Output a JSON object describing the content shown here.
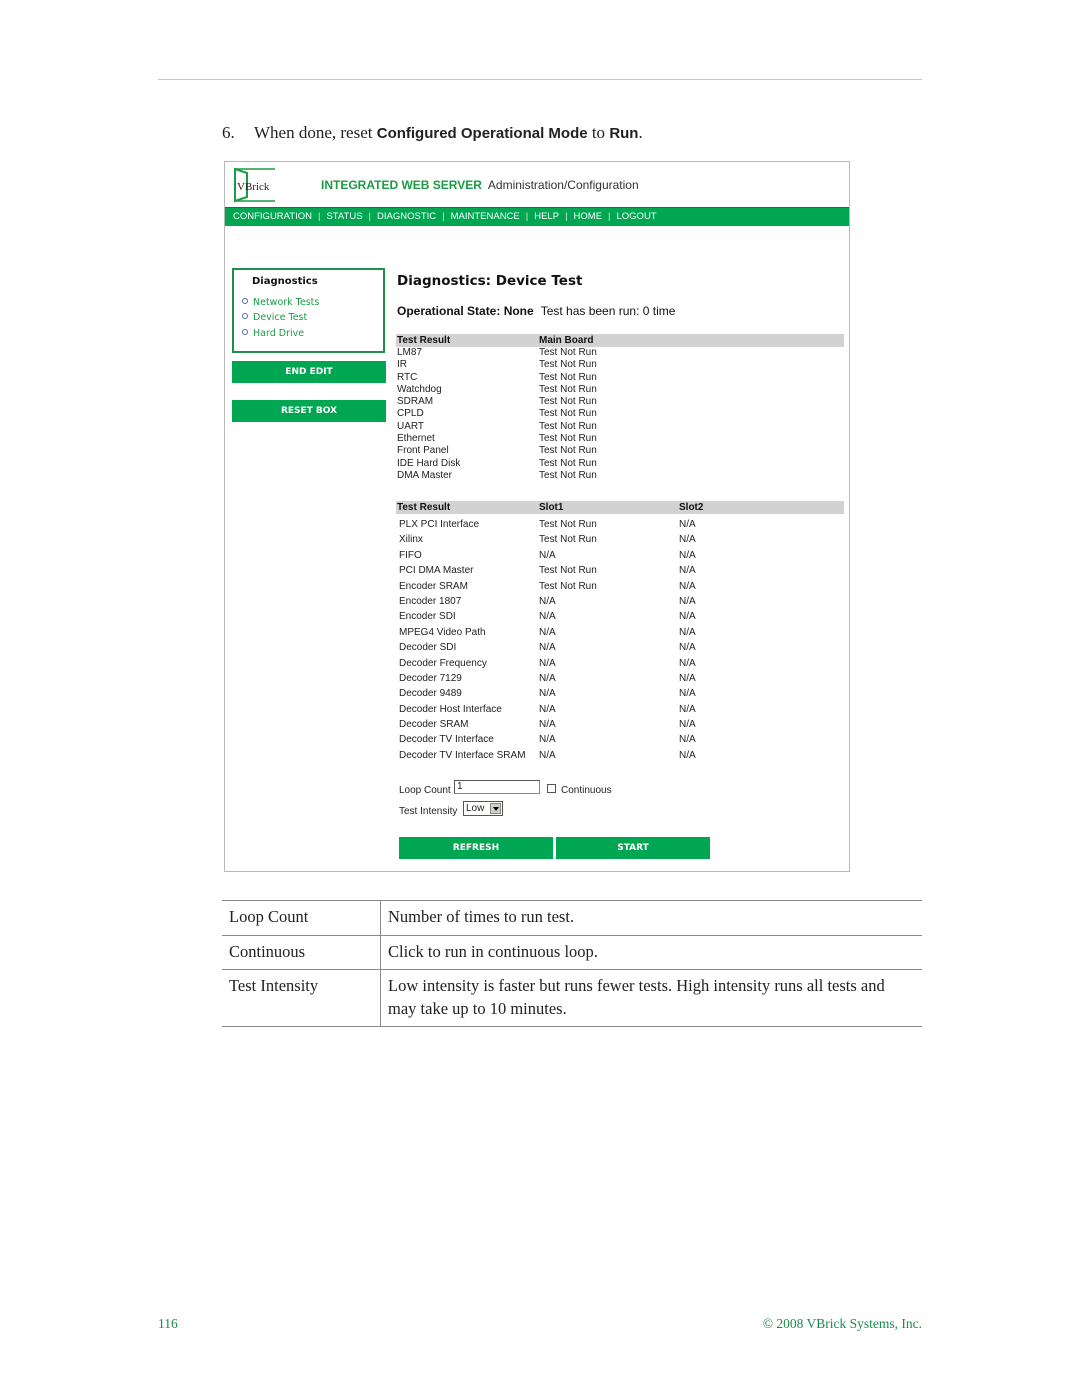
{
  "instruction": {
    "number": "6.",
    "text_before": "When done, reset ",
    "ui_term_1": "Configured Operational Mode",
    "text_middle": " to ",
    "ui_term_2": "Run",
    "text_after": "."
  },
  "screenshot": {
    "logo_text": "VBrick",
    "header_title": "INTEGRATED WEB SERVER",
    "header_subtitle": "Administration/Configuration",
    "nav": [
      "CONFIGURATION",
      "STATUS",
      "DIAGNOSTIC",
      "MAINTENANCE",
      "HELP",
      "HOME",
      "LOGOUT"
    ],
    "sidebar": {
      "title": "Diagnostics",
      "links": [
        "Network Tests",
        "Device Test",
        "Hard Drive"
      ],
      "end_edit": "END EDIT",
      "reset_box": "RESET BOX"
    },
    "main": {
      "title": "Diagnostics: Device Test",
      "op_state_label": "Operational State: None",
      "run_count_text": "Test has been run: 0 time"
    },
    "main_board_table": {
      "headers": [
        "Test Result",
        "Main Board"
      ],
      "rows": [
        [
          "LM87",
          "Test Not Run"
        ],
        [
          "IR",
          "Test Not Run"
        ],
        [
          "RTC",
          "Test Not Run"
        ],
        [
          "Watchdog",
          "Test Not Run"
        ],
        [
          "SDRAM",
          "Test Not Run"
        ],
        [
          "CPLD",
          "Test Not Run"
        ],
        [
          "UART",
          "Test Not Run"
        ],
        [
          "Ethernet",
          "Test Not Run"
        ],
        [
          "Front Panel",
          "Test Not Run"
        ],
        [
          "IDE Hard Disk",
          "Test Not Run"
        ],
        [
          "DMA Master",
          "Test Not Run"
        ]
      ]
    },
    "slot_table": {
      "headers": [
        "Test Result",
        "Slot1",
        "Slot2"
      ],
      "rows": [
        [
          "PLX PCI Interface",
          "Test Not Run",
          "N/A"
        ],
        [
          "Xilinx",
          "Test Not Run",
          "N/A"
        ],
        [
          "FIFO",
          "N/A",
          "N/A"
        ],
        [
          "PCI DMA Master",
          "Test Not Run",
          "N/A"
        ],
        [
          "Encoder SRAM",
          "Test Not Run",
          "N/A"
        ],
        [
          "Encoder 1807",
          "N/A",
          "N/A"
        ],
        [
          "Encoder SDI",
          "N/A",
          "N/A"
        ],
        [
          "MPEG4 Video Path",
          "N/A",
          "N/A"
        ],
        [
          "Decoder SDI",
          "N/A",
          "N/A"
        ],
        [
          "Decoder Frequency",
          "N/A",
          "N/A"
        ],
        [
          "Decoder 7129",
          "N/A",
          "N/A"
        ],
        [
          "Decoder 9489",
          "N/A",
          "N/A"
        ],
        [
          "Decoder Host Interface",
          "N/A",
          "N/A"
        ],
        [
          "Decoder SRAM",
          "N/A",
          "N/A"
        ],
        [
          "Decoder TV Interface",
          "N/A",
          "N/A"
        ],
        [
          "Decoder TV Interface SRAM",
          "N/A",
          "N/A"
        ]
      ]
    },
    "form": {
      "loop_count_label": "Loop Count",
      "loop_count_value": "1",
      "continuous_label": "Continuous",
      "continuous_checked": false,
      "test_intensity_label": "Test Intensity",
      "test_intensity_value": "Low",
      "refresh": "REFRESH",
      "start": "START"
    }
  },
  "description_table": [
    [
      "Loop Count",
      "Number of times to run test."
    ],
    [
      "Continuous",
      "Click to run in continuous loop."
    ],
    [
      "Test Intensity",
      "Low intensity is faster but runs fewer tests. High intensity runs all tests and may take up to 10 minutes."
    ]
  ],
  "footer": {
    "page_number": "116",
    "copyright": "© 2008 VBrick Systems, Inc."
  }
}
